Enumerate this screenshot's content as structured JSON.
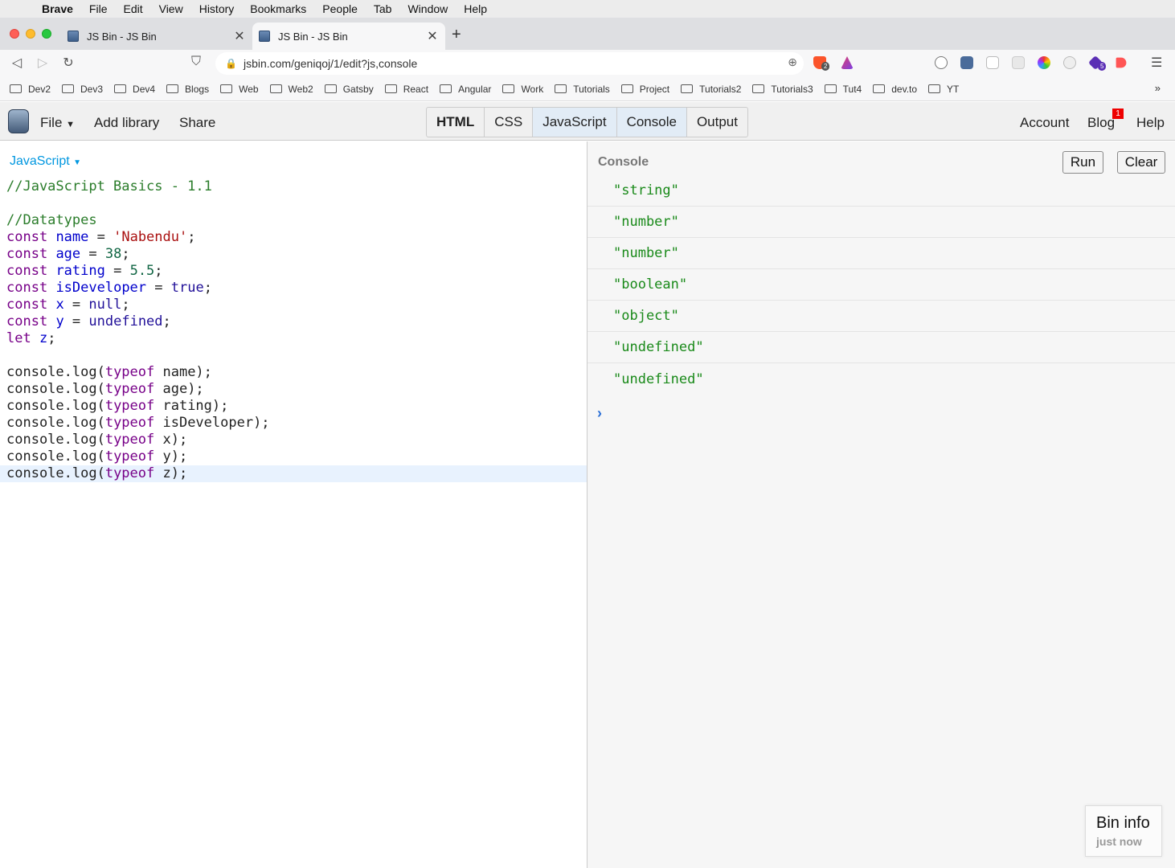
{
  "menubar": {
    "app": "Brave",
    "items": [
      "File",
      "Edit",
      "View",
      "History",
      "Bookmarks",
      "People",
      "Tab",
      "Window",
      "Help"
    ]
  },
  "tabs": [
    {
      "title": "JS Bin - JS Bin",
      "active": false
    },
    {
      "title": "JS Bin - JS Bin",
      "active": true
    }
  ],
  "address": {
    "url": "jsbin.com/geniqoj/1/edit?js,console"
  },
  "extensions": {
    "shield_count": "2",
    "badge_count": "5"
  },
  "bookmarks": [
    "Dev2",
    "Dev3",
    "Dev4",
    "Blogs",
    "Web",
    "Web2",
    "Gatsby",
    "React",
    "Angular",
    "Work",
    "Tutorials",
    "Project",
    "Tutorials2",
    "Tutorials3",
    "Tut4",
    "dev.to",
    "YT"
  ],
  "jsbin": {
    "file_menu": "File",
    "add_library": "Add library",
    "share": "Share",
    "panels": [
      "HTML",
      "CSS",
      "JavaScript",
      "Console",
      "Output"
    ],
    "account": "Account",
    "blog": "Blog",
    "blog_badge": "1",
    "help": "Help"
  },
  "editor": {
    "language": "JavaScript",
    "lines": [
      "//JavaScript Basics - 1.1",
      "",
      "//Datatypes",
      "const name = 'Nabendu';",
      "const age = 38;",
      "const rating = 5.5;",
      "const isDeveloper = true;",
      "const x = null;",
      "const y = undefined;",
      "let z;",
      "",
      "console.log(typeof name);",
      "console.log(typeof age);",
      "console.log(typeof rating);",
      "console.log(typeof isDeveloper);",
      "console.log(typeof x);",
      "console.log(typeof y);",
      "console.log(typeof z);"
    ]
  },
  "console": {
    "title": "Console",
    "run": "Run",
    "clear": "Clear",
    "output": [
      "\"string\"",
      "\"number\"",
      "\"number\"",
      "\"boolean\"",
      "\"object\"",
      "\"undefined\"",
      "\"undefined\""
    ],
    "prompt": "›"
  },
  "bin_info": {
    "title": "Bin info",
    "when": "just now"
  }
}
